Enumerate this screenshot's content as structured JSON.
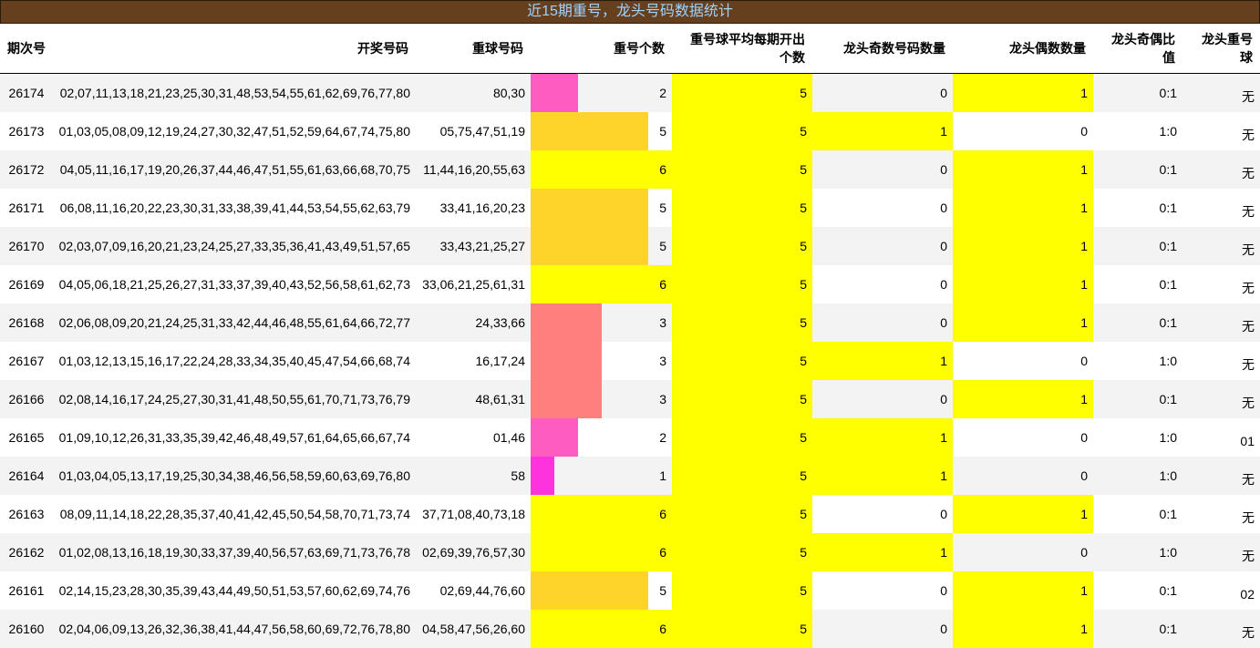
{
  "title": "近15期重号，龙头号码数据统计",
  "headers": [
    "期次号",
    "开奖号码",
    "重球号码",
    "重号个数",
    "重号球平均每期开出个数",
    "龙头奇数号码数量",
    "龙头偶数数量",
    "龙头奇偶比值",
    "龙头重号球"
  ],
  "bar_max": 6,
  "colors": {
    "title_bg": "#653f1e",
    "title_text": "#9fd3ff",
    "highlight": "#ffff00",
    "bar_1": "#ff33dd",
    "bar_2": "#ff5cc2",
    "bar_3": "#ff7f7f",
    "bar_5": "#ffd42a",
    "bar_6": "#ffff00"
  },
  "rows": [
    {
      "issue": "26174",
      "numbers": "02,07,11,13,18,21,23,25,30,31,48,53,54,55,61,62,69,76,77,80",
      "repeat_balls": "80,30",
      "repeat_count": "2",
      "avg": "5",
      "odd": "0",
      "even": "1",
      "ratio": "0:1",
      "head_repeat": "无"
    },
    {
      "issue": "26173",
      "numbers": "01,03,05,08,09,12,19,24,27,30,32,47,51,52,59,64,67,74,75,80",
      "repeat_balls": "05,75,47,51,19",
      "repeat_count": "5",
      "avg": "5",
      "odd": "1",
      "even": "0",
      "ratio": "1:0",
      "head_repeat": "无"
    },
    {
      "issue": "26172",
      "numbers": "04,05,11,16,17,19,20,26,37,44,46,47,51,55,61,63,66,68,70,75",
      "repeat_balls": "11,44,16,20,55,63",
      "repeat_count": "6",
      "avg": "5",
      "odd": "0",
      "even": "1",
      "ratio": "0:1",
      "head_repeat": "无"
    },
    {
      "issue": "26171",
      "numbers": "06,08,11,16,20,22,23,30,31,33,38,39,41,44,53,54,55,62,63,79",
      "repeat_balls": "33,41,16,20,23",
      "repeat_count": "5",
      "avg": "5",
      "odd": "0",
      "even": "1",
      "ratio": "0:1",
      "head_repeat": "无"
    },
    {
      "issue": "26170",
      "numbers": "02,03,07,09,16,20,21,23,24,25,27,33,35,36,41,43,49,51,57,65",
      "repeat_balls": "33,43,21,25,27",
      "repeat_count": "5",
      "avg": "5",
      "odd": "0",
      "even": "1",
      "ratio": "0:1",
      "head_repeat": "无"
    },
    {
      "issue": "26169",
      "numbers": "04,05,06,18,21,25,26,27,31,33,37,39,40,43,52,56,58,61,62,73",
      "repeat_balls": "33,06,21,25,61,31",
      "repeat_count": "6",
      "avg": "5",
      "odd": "0",
      "even": "1",
      "ratio": "0:1",
      "head_repeat": "无"
    },
    {
      "issue": "26168",
      "numbers": "02,06,08,09,20,21,24,25,31,33,42,44,46,48,55,61,64,66,72,77",
      "repeat_balls": "24,33,66",
      "repeat_count": "3",
      "avg": "5",
      "odd": "0",
      "even": "1",
      "ratio": "0:1",
      "head_repeat": "无"
    },
    {
      "issue": "26167",
      "numbers": "01,03,12,13,15,16,17,22,24,28,33,34,35,40,45,47,54,66,68,74",
      "repeat_balls": "16,17,24",
      "repeat_count": "3",
      "avg": "5",
      "odd": "1",
      "even": "0",
      "ratio": "1:0",
      "head_repeat": "无"
    },
    {
      "issue": "26166",
      "numbers": "02,08,14,16,17,24,25,27,30,31,41,48,50,55,61,70,71,73,76,79",
      "repeat_balls": "48,61,31",
      "repeat_count": "3",
      "avg": "5",
      "odd": "0",
      "even": "1",
      "ratio": "0:1",
      "head_repeat": "无"
    },
    {
      "issue": "26165",
      "numbers": "01,09,10,12,26,31,33,35,39,42,46,48,49,57,61,64,65,66,67,74",
      "repeat_balls": "01,46",
      "repeat_count": "2",
      "avg": "5",
      "odd": "1",
      "even": "0",
      "ratio": "1:0",
      "head_repeat": "01"
    },
    {
      "issue": "26164",
      "numbers": "01,03,04,05,13,17,19,25,30,34,38,46,56,58,59,60,63,69,76,80",
      "repeat_balls": "58",
      "repeat_count": "1",
      "avg": "5",
      "odd": "1",
      "even": "0",
      "ratio": "1:0",
      "head_repeat": "无"
    },
    {
      "issue": "26163",
      "numbers": "08,09,11,14,18,22,28,35,37,40,41,42,45,50,54,58,70,71,73,74",
      "repeat_balls": "37,71,08,40,73,18",
      "repeat_count": "6",
      "avg": "5",
      "odd": "0",
      "even": "1",
      "ratio": "0:1",
      "head_repeat": "无"
    },
    {
      "issue": "26162",
      "numbers": "01,02,08,13,16,18,19,30,33,37,39,40,56,57,63,69,71,73,76,78",
      "repeat_balls": "02,69,39,76,57,30",
      "repeat_count": "6",
      "avg": "5",
      "odd": "1",
      "even": "0",
      "ratio": "1:0",
      "head_repeat": "无"
    },
    {
      "issue": "26161",
      "numbers": "02,14,15,23,28,30,35,39,43,44,49,50,51,53,57,60,62,69,74,76",
      "repeat_balls": "02,69,44,76,60",
      "repeat_count": "5",
      "avg": "5",
      "odd": "0",
      "even": "1",
      "ratio": "0:1",
      "head_repeat": "02"
    },
    {
      "issue": "26160",
      "numbers": "02,04,06,09,13,26,32,36,38,41,44,47,56,58,60,69,72,76,78,80",
      "repeat_balls": "04,58,47,56,26,60",
      "repeat_count": "6",
      "avg": "5",
      "odd": "0",
      "even": "1",
      "ratio": "0:1",
      "head_repeat": "无"
    }
  ]
}
